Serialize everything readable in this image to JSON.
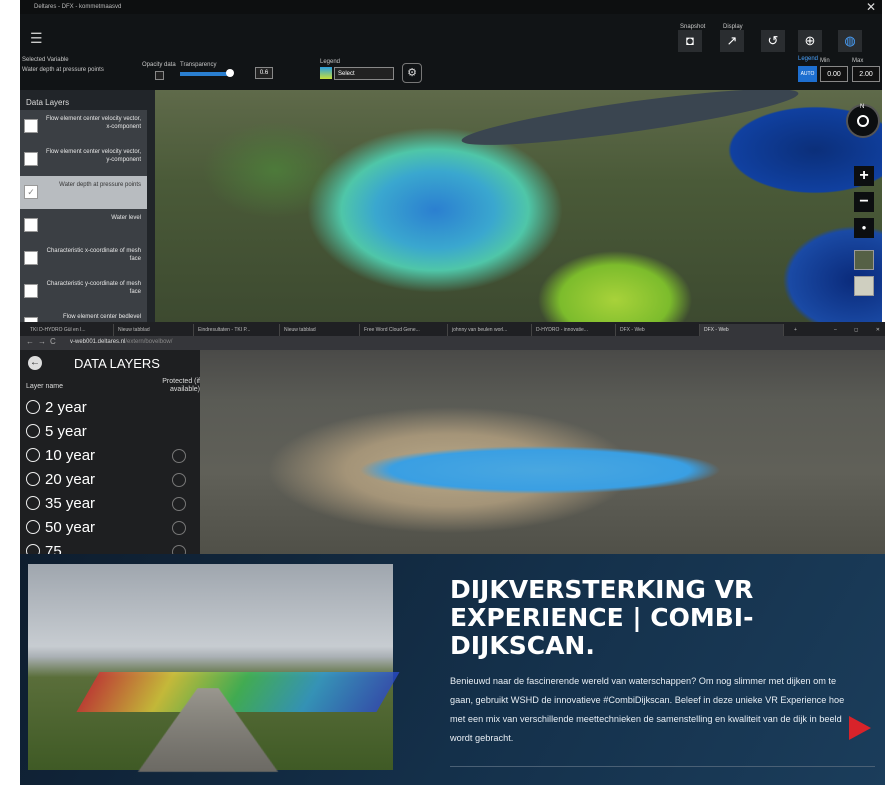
{
  "dfx": {
    "window_title": "Deltares - DFX - kommetmaasvd",
    "close_glyph": "✕",
    "menu_glyph": "☰",
    "selected_variable_label": "Selected Variable",
    "selected_variable_value": "Water depth at pressure points",
    "opacity_label": "Opacity data",
    "transparency_label": "Transparency",
    "transparency_value": "0.6",
    "legend_label": "Legend",
    "legend_select": "Select",
    "snapshot_label": "Snapshot",
    "display_label": "Display",
    "legend_right_label": "Legend",
    "min_label": "Min",
    "max_label": "Max",
    "auto_button": "AUTO",
    "min_value": "0.00",
    "max_value": "2.00",
    "data_layers_title": "Data Layers",
    "layers": [
      {
        "label": "Flow element center velocity vector, x-component",
        "checked": false
      },
      {
        "label": "Flow element center velocity vector, y-component",
        "checked": false
      },
      {
        "label": "Water depth at pressure points",
        "checked": true
      },
      {
        "label": "Water level",
        "checked": false
      },
      {
        "label": "Characteristic x-coordinate of mesh face",
        "checked": false
      },
      {
        "label": "Characteristic y-coordinate of mesh face",
        "checked": false
      },
      {
        "label": "Flow element center bedlevel",
        "checked": false
      }
    ],
    "compass_n": "N",
    "zoom_in": "+",
    "zoom_out": "−",
    "locate": "●"
  },
  "browser": {
    "tabs": [
      "TKI D-HYDRO Gül en I...",
      "Nieuw tabblad",
      "Eindresultaten - TKI P...",
      "Nieuw tabblad",
      "Free Word Cloud Gene...",
      "johnny van beulen worl...",
      "D-HYDRO - innovatie...",
      "DFX - Web",
      "DFX - Web"
    ],
    "url_domain": "v-web001.deltares.nl",
    "url_path": "/extern/bovelbow/",
    "panel_title": "DATA LAYERS",
    "col_layer": "Layer name",
    "col_protected": "Protected (if available)",
    "years": [
      "2 year",
      "5 year",
      "10 year",
      "20 year",
      "35 year",
      "50 year",
      "75"
    ]
  },
  "vr": {
    "title": "DIJKVERSTERKING VR EXPERIENCE | COMBI-DIJKSCAN.",
    "body": "Benieuwd naar de fascinerende wereld van waterschappen? Om nog slimmer met dijken om te gaan, gebruikt WSHD de innovatieve #CombiDijkscan. Beleef in deze unieke VR Experience hoe met een mix van verschillende meettechnieken de samenstelling en kwaliteit van de dijk in beeld wordt gebracht.",
    "accent_color": "#d8232a"
  }
}
